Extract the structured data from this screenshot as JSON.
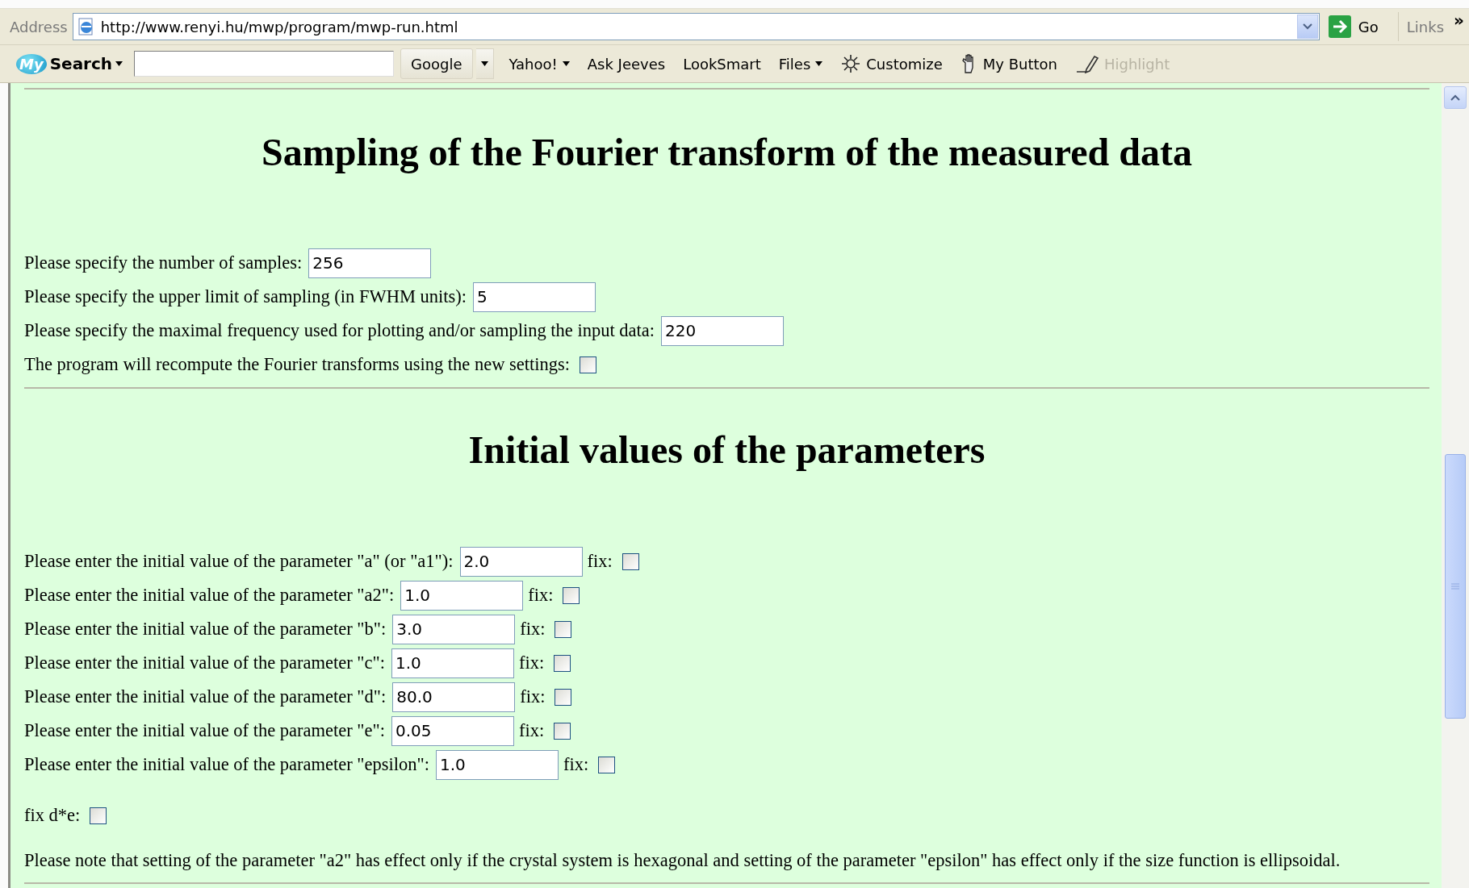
{
  "address_bar": {
    "label": "Address",
    "url": "http://www.renyi.hu/mwp/program/mwp-run.html",
    "go": "Go",
    "links": "Links",
    "more": "»"
  },
  "search_toolbar": {
    "logo": "My",
    "brand": "Search",
    "items": [
      {
        "label": "Google",
        "kind": "split",
        "disabled": false
      },
      {
        "label": "Yahoo!",
        "kind": "menu",
        "disabled": false
      },
      {
        "label": "Ask Jeeves",
        "kind": "plain",
        "disabled": false
      },
      {
        "label": "LookSmart",
        "kind": "plain",
        "disabled": false
      },
      {
        "label": "Files",
        "kind": "menu",
        "disabled": false
      },
      {
        "label": "Customize",
        "kind": "customize",
        "disabled": false
      },
      {
        "label": "My Button",
        "kind": "custom",
        "disabled": false
      },
      {
        "label": "Highlight",
        "kind": "highlight",
        "disabled": true
      }
    ]
  },
  "sampling": {
    "title": "Sampling of the Fourier transform of the measured data",
    "fields": [
      {
        "kind": "text",
        "label": "Please specify the number of samples:",
        "value": "256"
      },
      {
        "kind": "text",
        "label": "Please specify the upper limit of sampling (in FWHM units):",
        "value": "5"
      },
      {
        "kind": "text",
        "label": "Please specify the maximal frequency used for plotting and/or sampling the input data:",
        "value": "220"
      },
      {
        "kind": "checkbox",
        "label": "The program will recompute the Fourier transforms using the new settings:",
        "checked": false
      }
    ]
  },
  "parameters": {
    "title": "Initial values of the parameters",
    "rows": [
      {
        "label": "Please enter the initial value of the parameter \"a\" (or \"a1\"):",
        "value": "2.0",
        "fix_label": "fix:",
        "fix_checked": false
      },
      {
        "label": "Please enter the initial value of the parameter \"a2\":",
        "value": "1.0",
        "fix_label": "fix:",
        "fix_checked": false
      },
      {
        "label": "Please enter the initial value of the parameter \"b\":",
        "value": "3.0",
        "fix_label": "fix:",
        "fix_checked": false
      },
      {
        "label": "Please enter the initial value of the parameter \"c\":",
        "value": "1.0",
        "fix_label": "fix:",
        "fix_checked": false
      },
      {
        "label": "Please enter the initial value of the parameter \"d\":",
        "value": "80.0",
        "fix_label": "fix:",
        "fix_checked": false
      },
      {
        "label": "Please enter the initial value of the parameter \"e\":",
        "value": "0.05",
        "fix_label": "fix:",
        "fix_checked": false
      },
      {
        "label": "Please enter the initial value of the parameter \"epsilon\":",
        "value": "1.0",
        "fix_label": "fix:",
        "fix_checked": false
      }
    ],
    "fix_de": {
      "label": "fix d*e:",
      "checked": false
    },
    "note": "Please note that setting of the parameter \"a2\" has effect only if the crystal system is hexagonal and setting of the parameter \"epsilon\" has effect only if the size function is ellipsoidal."
  }
}
